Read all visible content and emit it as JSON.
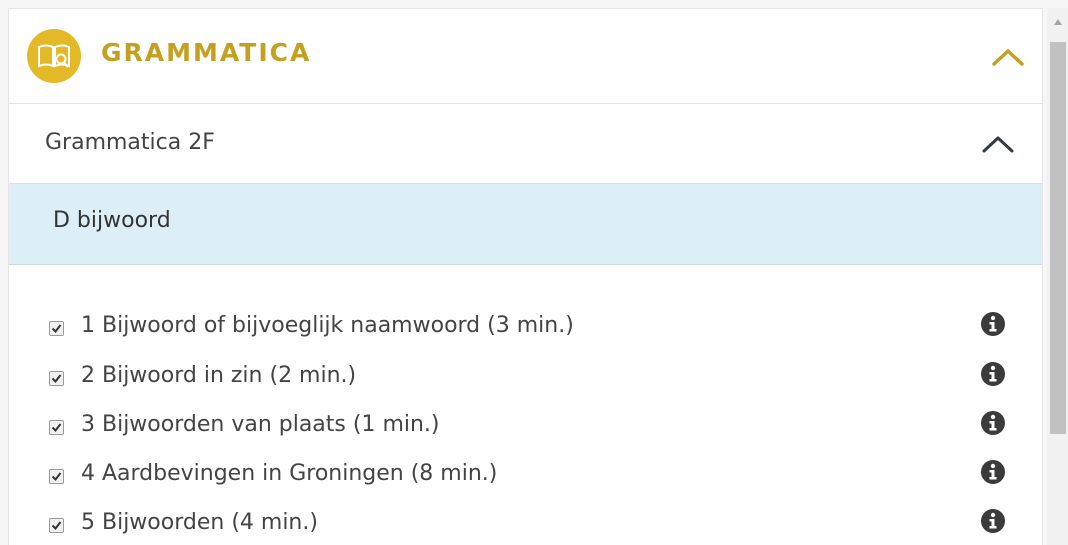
{
  "section": {
    "title": "GRAMMATICA",
    "badge_icon": "book-icon",
    "toggle_icon": "chevron-up-icon",
    "accent_color": "#e3b928"
  },
  "subsection": {
    "title": "Grammatica 2F",
    "toggle_icon": "chevron-up-icon"
  },
  "topic": {
    "label": "D bijwoord",
    "highlight_color": "#dceef6"
  },
  "lessons": [
    {
      "label": "1 Bijwoord of bijvoeglijk naamwoord (3 min.)",
      "checked": true,
      "icon": "info-icon"
    },
    {
      "label": "2 Bijwoord in zin (2 min.)",
      "checked": true,
      "icon": "info-icon"
    },
    {
      "label": "3 Bijwoorden van plaats (1 min.)",
      "checked": true,
      "icon": "info-icon"
    },
    {
      "label": "4 Aardbevingen in Groningen (8 min.)",
      "checked": true,
      "icon": "info-icon"
    },
    {
      "label": "5 Bijwoorden (4 min.)",
      "checked": true,
      "icon": "info-icon"
    }
  ]
}
